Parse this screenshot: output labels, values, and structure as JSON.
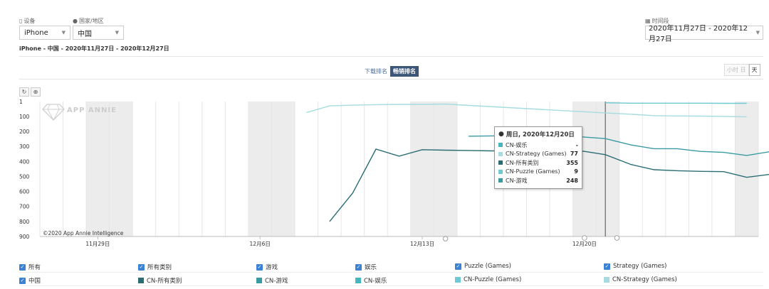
{
  "filters": {
    "device_label": "设备",
    "device_value": "iPhone",
    "region_label": "国家/地区",
    "region_value": "中国",
    "period_label": "时间段",
    "period_value": "2020年11月27日 - 2020年12月27日"
  },
  "summary": "iPhone - 中国 - 2020年11月27日 - 2020年12月27日",
  "tabs": {
    "download": "下载排名",
    "grossing": "畅销排名"
  },
  "granularity": {
    "hour": "小时",
    "day_short": "日",
    "day": "天"
  },
  "tools": {
    "reset": "↻",
    "zoom": "⊕"
  },
  "watermark": "APP ANNIE",
  "copyright": "©2020 App Annie Intelligence",
  "chart_data": {
    "type": "line",
    "y_inverted": true,
    "ylim": [
      1,
      900
    ],
    "y_ticks": [
      "1",
      "100",
      "200",
      "300",
      "400",
      "500",
      "600",
      "700",
      "800",
      "900"
    ],
    "x_ticks": [
      "11月29日",
      "12月6日",
      "12月13日",
      "12月20日"
    ],
    "x_tick_days": [
      2,
      9,
      16,
      23
    ],
    "x_range_days": [
      -0.5,
      30.5
    ],
    "weekend_bands": [
      [
        1.5,
        3.5
      ],
      [
        8.5,
        10.5
      ],
      [
        15.5,
        17.5
      ],
      [
        22.5,
        24.5
      ],
      [
        29.5,
        30.5
      ]
    ],
    "crosshair_day": 23.9,
    "series": [
      {
        "name": "CN-Strategy (Games)",
        "color": "#a6dce0",
        "points": [
          [
            11,
            75
          ],
          [
            12,
            30
          ],
          [
            13,
            25
          ],
          [
            14,
            22
          ],
          [
            15,
            20
          ],
          [
            16,
            20
          ],
          [
            17,
            18
          ],
          [
            23.9,
            77
          ],
          [
            25,
            85
          ],
          [
            26,
            95
          ],
          [
            27,
            97
          ],
          [
            28,
            98
          ],
          [
            29,
            100
          ],
          [
            30,
            103
          ]
        ]
      },
      {
        "name": "CN-Puzzle (Games)",
        "color": "#6fc9d2",
        "points": [
          [
            23.9,
            9
          ],
          [
            25,
            12
          ],
          [
            26,
            12
          ],
          [
            27,
            12
          ],
          [
            28,
            12
          ],
          [
            29,
            13
          ],
          [
            30,
            13
          ]
        ]
      },
      {
        "name": "CN-游戏",
        "color": "#3a9aa2",
        "points": [
          [
            18,
            232
          ],
          [
            19,
            230
          ],
          [
            20,
            230
          ],
          [
            21,
            228
          ],
          [
            22,
            226
          ],
          [
            23,
            238
          ],
          [
            23.9,
            248
          ],
          [
            25,
            290
          ],
          [
            26,
            315
          ],
          [
            27,
            315
          ],
          [
            28,
            333
          ],
          [
            29,
            340
          ],
          [
            30,
            360
          ],
          [
            31,
            335
          ]
        ]
      },
      {
        "name": "CN-所有类别",
        "color": "#2b6d73",
        "points": [
          [
            12,
            800
          ],
          [
            13,
            610
          ],
          [
            14,
            318
          ],
          [
            15,
            365
          ],
          [
            16,
            322
          ],
          [
            17,
            325
          ],
          [
            18,
            327
          ],
          [
            19,
            330
          ],
          [
            20,
            328
          ],
          [
            21,
            322
          ],
          [
            22,
            320
          ],
          [
            23,
            333
          ],
          [
            23.9,
            355
          ],
          [
            25,
            420
          ],
          [
            26,
            455
          ],
          [
            27,
            462
          ],
          [
            28,
            466
          ],
          [
            29,
            468
          ],
          [
            30,
            506
          ],
          [
            31,
            486
          ]
        ]
      }
    ],
    "markers": [
      {
        "day": 17,
        "value": 915
      },
      {
        "day": 23,
        "value": 910
      },
      {
        "day": 24.4,
        "value": 910
      }
    ]
  },
  "tooltip": {
    "title": "周日, 2020年12月20日",
    "rows": [
      {
        "name": "CN-娱乐",
        "value": "-",
        "color": "#45b5c0"
      },
      {
        "name": "CN-Strategy (Games)",
        "value": "77",
        "color": "#a6dce0"
      },
      {
        "name": "CN-所有类别",
        "value": "355",
        "color": "#2b6d73"
      },
      {
        "name": "CN-Puzzle (Games)",
        "value": "9",
        "color": "#6fc9d2"
      },
      {
        "name": "CN-游戏",
        "value": "248",
        "color": "#3a9aa2"
      }
    ]
  },
  "legend": {
    "categories": [
      "所有",
      "所有类别",
      "游戏",
      "娱乐",
      "Puzzle (Games)",
      "Strategy (Games)"
    ],
    "region": "中国",
    "series": [
      {
        "name": "CN-所有类别",
        "color": "#2b6d73"
      },
      {
        "name": "CN-游戏",
        "color": "#3a9aa2"
      },
      {
        "name": "CN-娱乐",
        "color": "#45b5c0"
      },
      {
        "name": "CN-Puzzle (Games)",
        "color": "#6fc9d2"
      },
      {
        "name": "CN-Strategy (Games)",
        "color": "#a6dce0"
      }
    ]
  }
}
